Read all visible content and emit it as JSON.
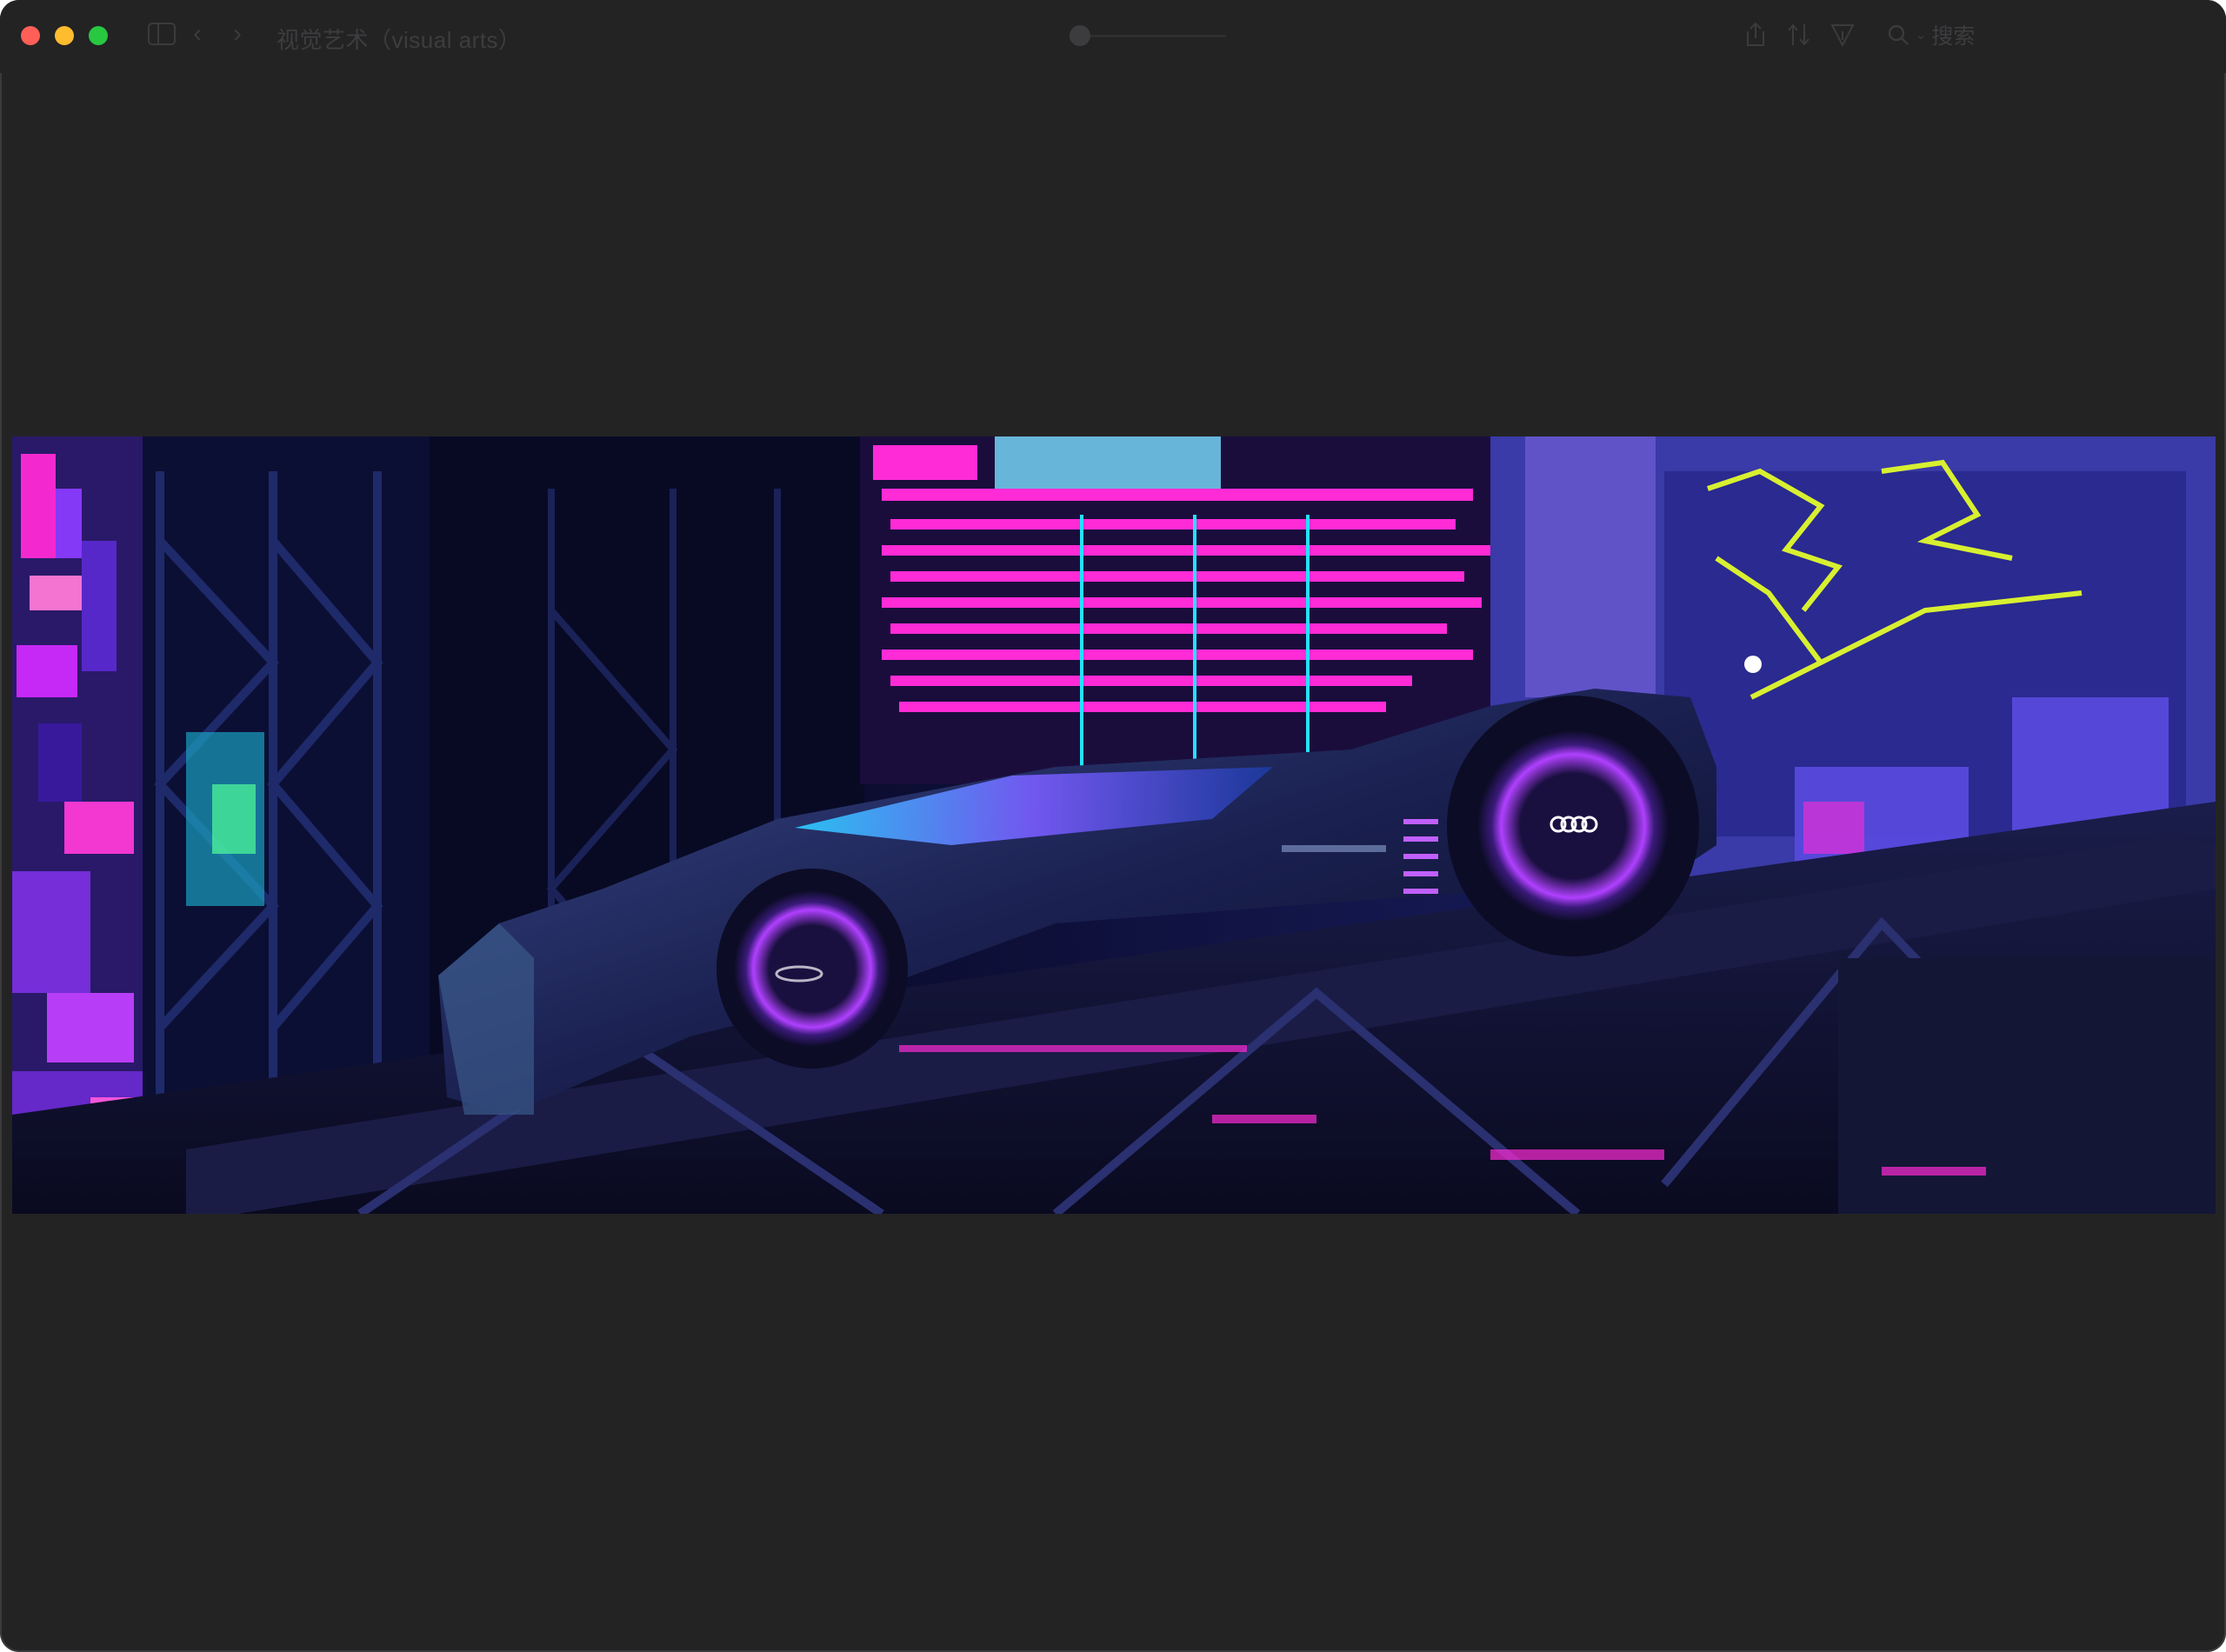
{
  "window": {
    "title": "视觉艺术（visual arts）",
    "search_label": "搜索"
  },
  "colors": {
    "window_bg": "#232324",
    "close": "#ff5f57",
    "minimize": "#febc2e",
    "maximize": "#28c840",
    "neon_magenta": "#ff2bd6",
    "neon_cyan": "#26e0ff",
    "neon_yellow": "#d8f030",
    "deep_blue": "#0b0f3a"
  },
  "icons": {
    "sidebar": "sidebar-toggle-icon",
    "back": "chevron-left-icon",
    "forward": "chevron-right-icon",
    "share": "share-icon",
    "rotate": "rotate-icon",
    "markup": "markup-pen-icon",
    "search": "search-icon"
  }
}
